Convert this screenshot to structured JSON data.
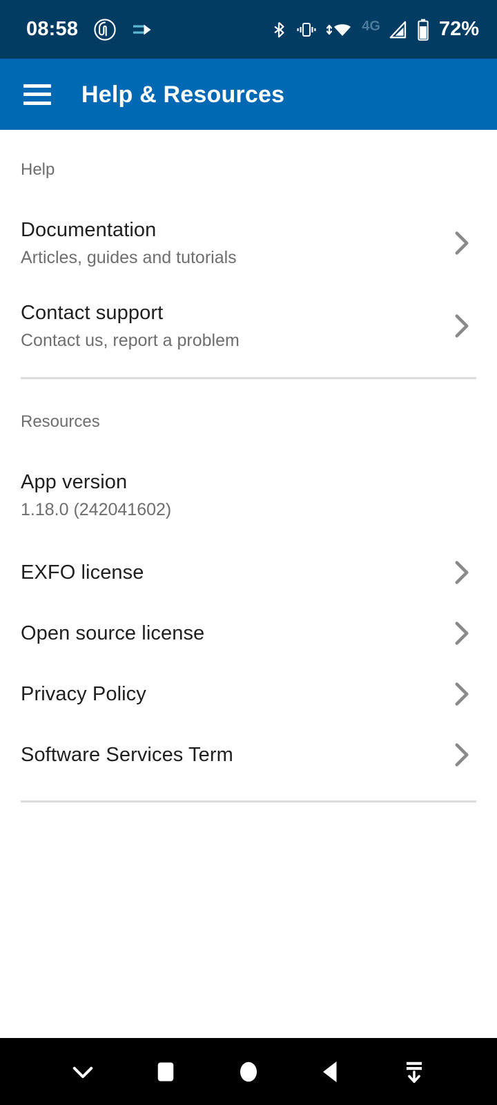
{
  "status_bar": {
    "time": "08:58",
    "battery_percent": "72%",
    "network_label": "4G",
    "background_color": "#033c63",
    "icons": [
      "fingerprint-icon",
      "exfo-logo-icon",
      "bluetooth-icon",
      "vibrate-icon",
      "wifi-icon",
      "cellular-signal-icon",
      "battery-icon"
    ]
  },
  "app_bar": {
    "title": "Help & Resources",
    "menu_icon": "hamburger-menu-icon",
    "background_color": "#0069b4"
  },
  "sections": [
    {
      "label": "Help",
      "rows": [
        {
          "title": "Documentation",
          "subtitle": "Articles, guides and tutorials",
          "chevron": true
        },
        {
          "title": "Contact support",
          "subtitle": "Contact us, report a problem",
          "chevron": true
        }
      ]
    },
    {
      "label": "Resources",
      "rows": [
        {
          "title": "App version",
          "subtitle": "1.18.0 (242041602)",
          "chevron": false
        },
        {
          "title": "EXFO license",
          "subtitle": "",
          "chevron": true
        },
        {
          "title": "Open source license",
          "subtitle": "",
          "chevron": true
        },
        {
          "title": "Privacy Policy",
          "subtitle": "",
          "chevron": true
        },
        {
          "title": "Software Services Term",
          "subtitle": "",
          "chevron": true
        }
      ]
    }
  ],
  "nav_bar": {
    "background_color": "#000000",
    "buttons": [
      "chevron-down-icon",
      "recents-square-icon",
      "home-circle-icon",
      "back-triangle-icon",
      "hide-keyboard-icon"
    ]
  }
}
